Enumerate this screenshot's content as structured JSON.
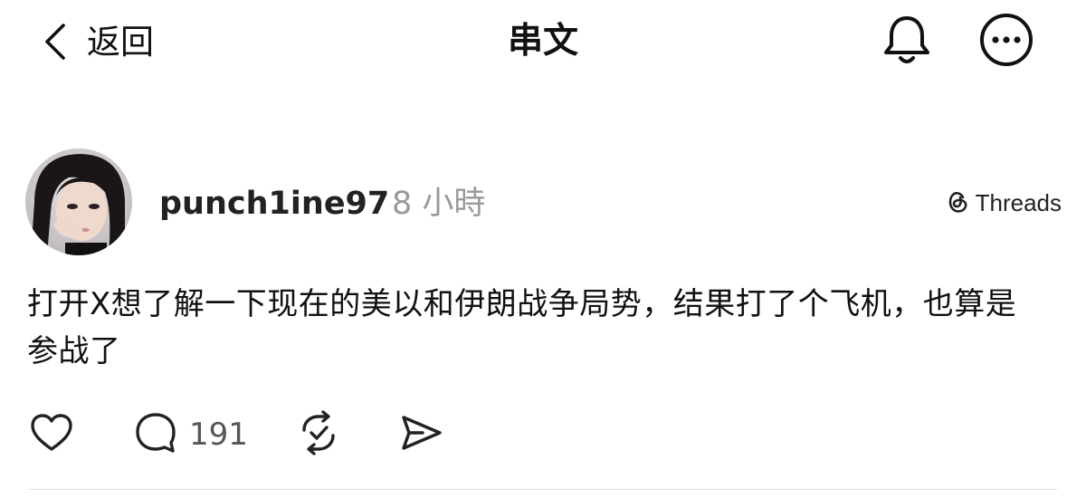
{
  "header": {
    "back_label": "返回",
    "title": "串文",
    "icons": {
      "back": "chevron-left-icon",
      "notifications": "bell-icon",
      "more": "more-circle-icon"
    }
  },
  "post": {
    "username": "punch1ine97",
    "timestamp": "8 小時",
    "source_badge": "Threads",
    "text": "打开X想了解一下现在的美以和伊朗战争局势，结果打了个飞机，也算是参战了",
    "reply_count": "191",
    "action_icons": [
      "heart-icon",
      "comment-icon",
      "repost-icon",
      "share-icon"
    ]
  },
  "colors": {
    "text": "#111111",
    "muted": "#9a9a9a",
    "divider": "#dddddd",
    "background": "#ffffff"
  }
}
